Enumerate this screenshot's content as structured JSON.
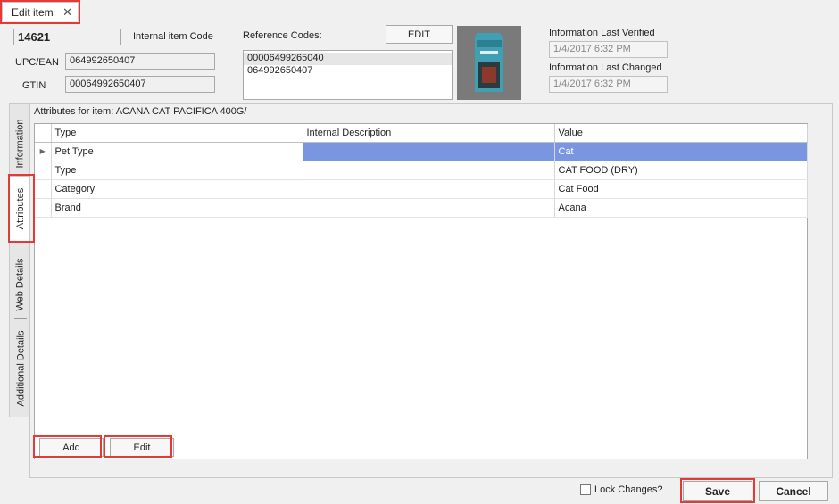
{
  "tab": {
    "title": "Edit item",
    "close_glyph": "✕"
  },
  "item": {
    "code": "14621",
    "code_label": "Internal item Code",
    "upc_label": "UPC/EAN",
    "upc_value": "064992650407",
    "gtin_label": "GTIN",
    "gtin_value": "00064992650407"
  },
  "reference": {
    "label": "Reference Codes:",
    "edit_label": "EDIT",
    "codes": [
      "00006499265040",
      "064992650407"
    ]
  },
  "info": {
    "verified_label": "Information Last Verified",
    "verified_value": "1/4/2017 6:32 PM",
    "changed_label": "Information Last Changed",
    "changed_value": "1/4/2017 6:32 PM"
  },
  "side_tabs": [
    "Information",
    "Attributes",
    "Web Details",
    "Additional Details"
  ],
  "attributes": {
    "title": "Attributes for item:  ACANA CAT PACIFICA 400G/",
    "columns": [
      "Type",
      "Internal Description",
      "Value"
    ],
    "rows": [
      {
        "type": "Pet Type",
        "desc": "",
        "value": "Cat"
      },
      {
        "type": "Type",
        "desc": "",
        "value": "CAT FOOD (DRY)"
      },
      {
        "type": "Category",
        "desc": "",
        "value": "Cat Food"
      },
      {
        "type": "Brand",
        "desc": "",
        "value": "Acana"
      }
    ],
    "row_indicator": "▶",
    "add_label": "Add",
    "edit_label": "Edit"
  },
  "footer": {
    "lock_label": "Lock Changes?",
    "save_label": "Save",
    "cancel_label": "Cancel"
  },
  "colors": {
    "highlight": "#e53935",
    "selection": "#7b96e0"
  }
}
